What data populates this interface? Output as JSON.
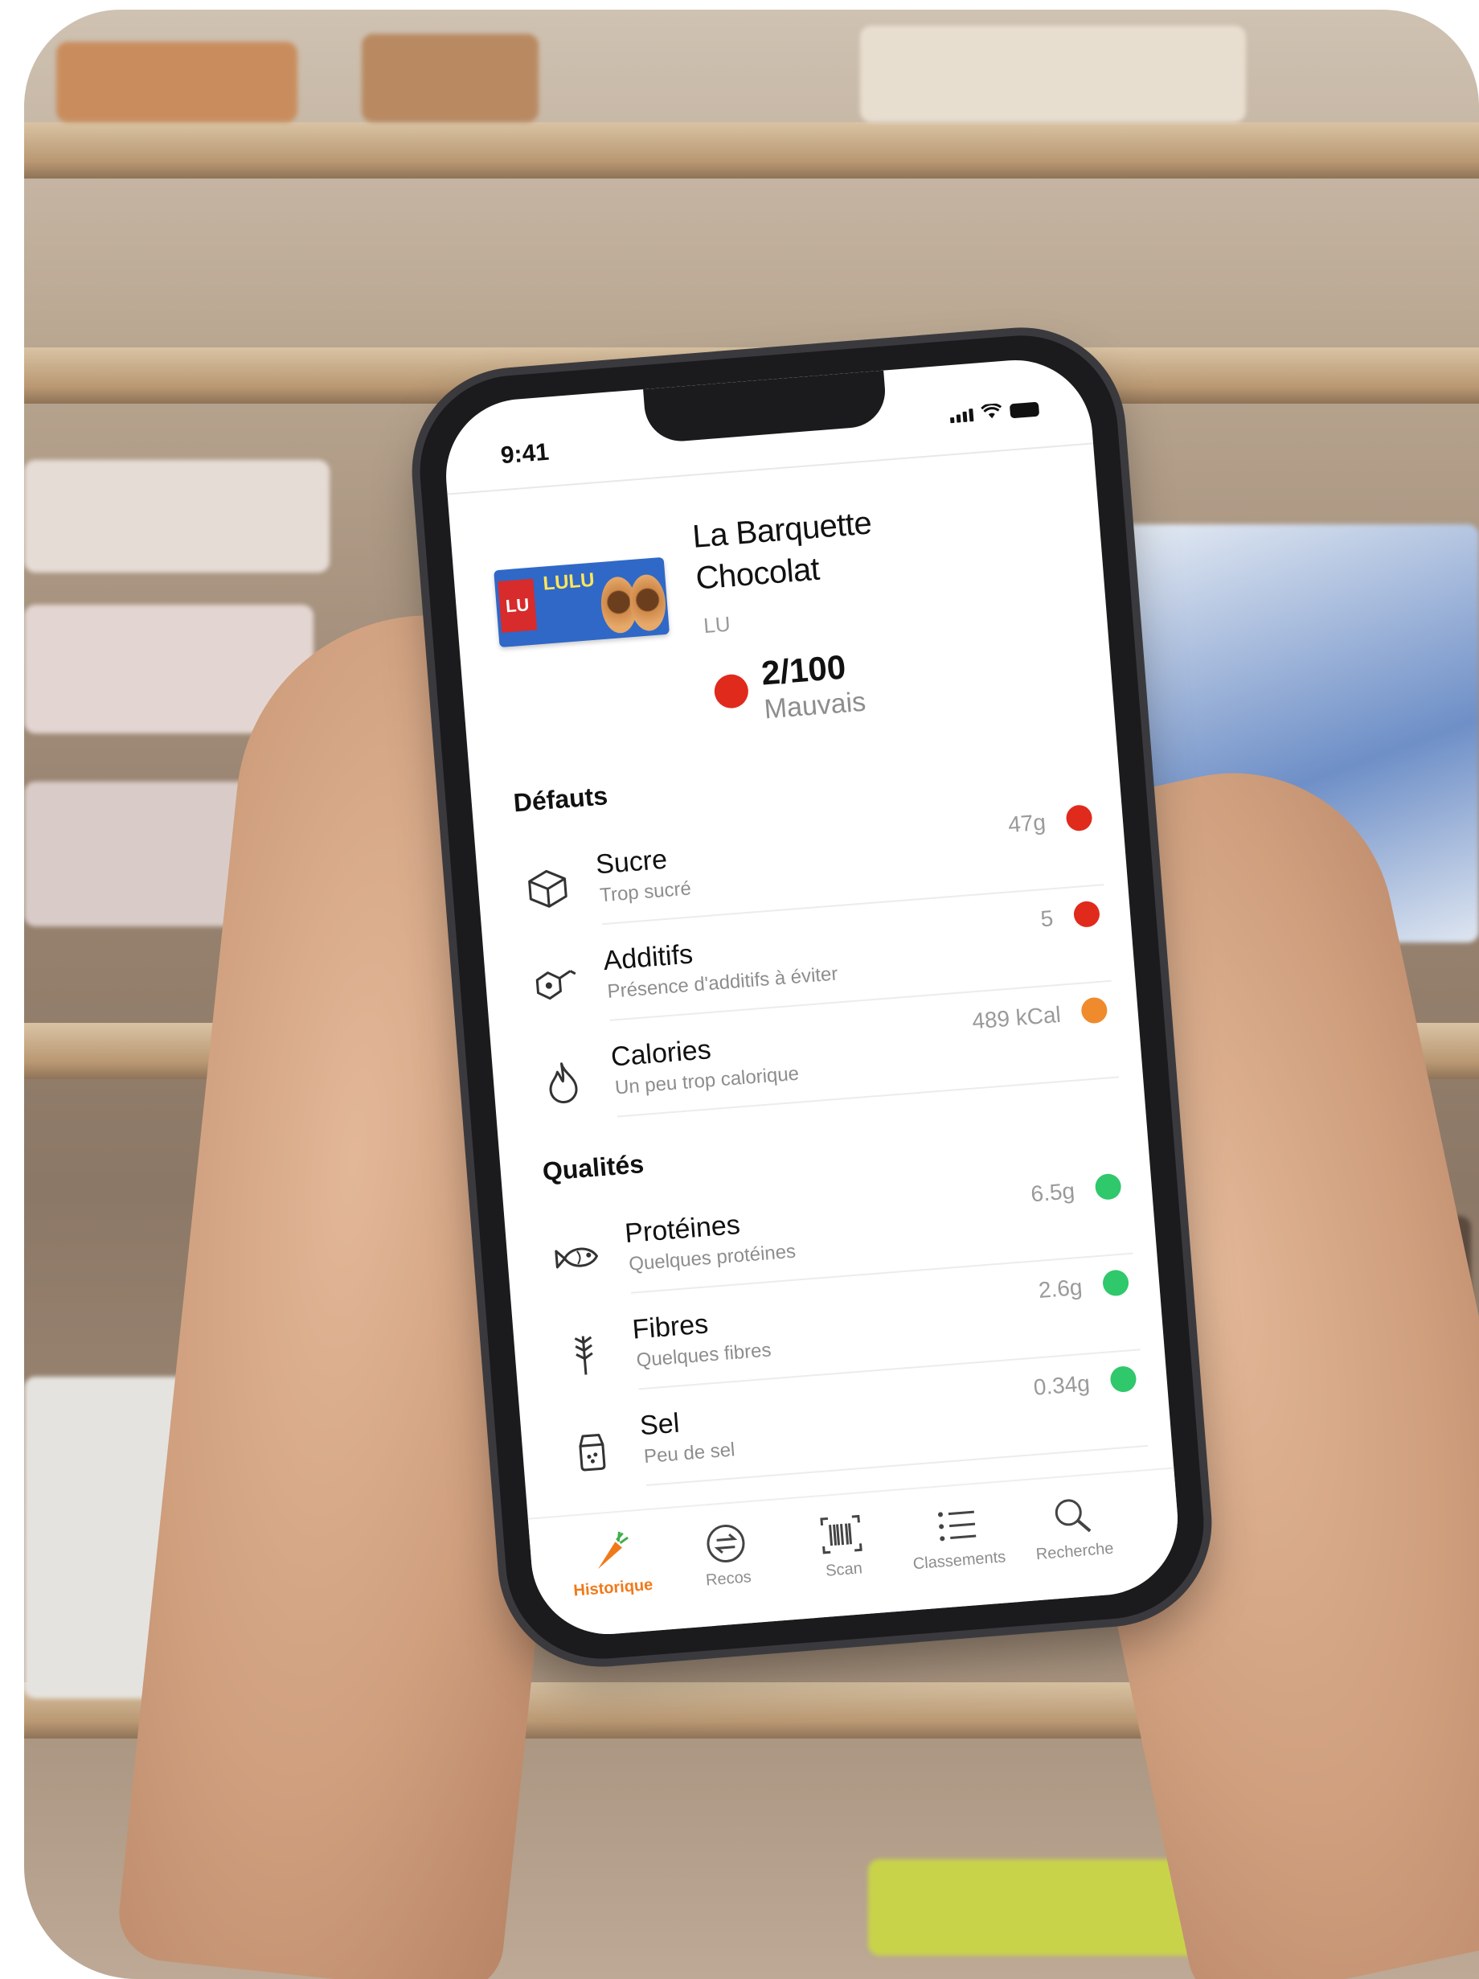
{
  "status_bar": {
    "time": "9:41"
  },
  "product": {
    "name_line1": "La Barquette",
    "name_line2": "Chocolat",
    "brand": "LU",
    "packaging_text": "LULU",
    "packaging_badge": "LU",
    "score": "2/100",
    "score_label": "Mauvais",
    "score_color": "#e02a1c"
  },
  "defauts": {
    "title": "Défauts",
    "items": [
      {
        "name": "Sucre",
        "detail": "Trop sucré",
        "value": "47g",
        "icon": "sugar-cube-icon",
        "color": "#e02a1c"
      },
      {
        "name": "Additifs",
        "detail": "Présence d'additifs à éviter",
        "value": "5",
        "icon": "molecule-icon",
        "color": "#e02a1c"
      },
      {
        "name": "Calories",
        "detail": "Un peu trop calorique",
        "value": "489 kCal",
        "icon": "flame-icon",
        "color": "#ef8b2c"
      }
    ]
  },
  "qualites": {
    "title": "Qualités",
    "items": [
      {
        "name": "Protéines",
        "detail": "Quelques protéines",
        "value": "6.5g",
        "icon": "fish-icon",
        "color": "#2fc86b"
      },
      {
        "name": "Fibres",
        "detail": "Quelques fibres",
        "value": "2.6g",
        "icon": "wheat-icon",
        "color": "#2fc86b"
      },
      {
        "name": "Sel",
        "detail": "Peu de sel",
        "value": "0.34g",
        "icon": "salt-shaker-icon",
        "color": "#2fc86b"
      }
    ]
  },
  "tabbar": {
    "items": [
      {
        "label": "Historique",
        "icon": "carrot-icon",
        "active": true
      },
      {
        "label": "Recos",
        "icon": "swap-icon",
        "active": false
      },
      {
        "label": "Scan",
        "icon": "barcode-icon",
        "active": false
      },
      {
        "label": "Classements",
        "icon": "list-icon",
        "active": false
      },
      {
        "label": "Recherche",
        "icon": "search-icon",
        "active": false
      }
    ],
    "active_color": "#f07a1a"
  }
}
